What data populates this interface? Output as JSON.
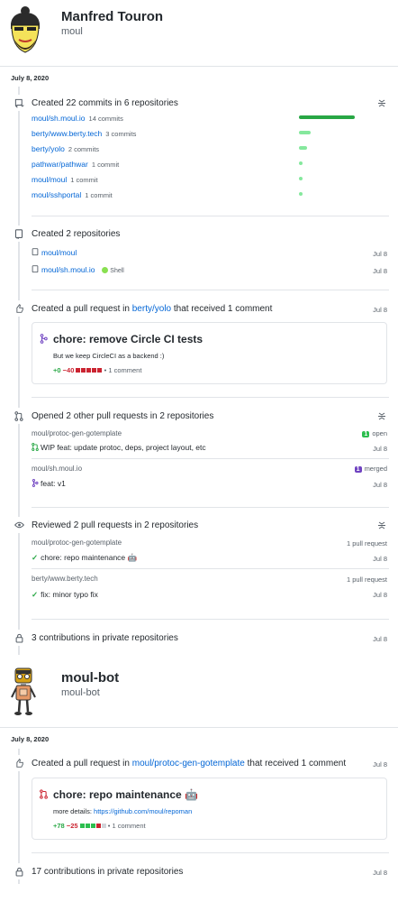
{
  "profile1": {
    "name": "Manfred Touron",
    "login": "moul"
  },
  "day1": {
    "date": "July 8, 2020",
    "commits": {
      "title": "Created 22 commits in 6 repositories",
      "repos": [
        {
          "name": "moul/sh.moul.io",
          "count": "14 commits",
          "value": 14
        },
        {
          "name": "berty/www.berty.tech",
          "count": "3 commits",
          "value": 3
        },
        {
          "name": "berty/yolo",
          "count": "2 commits",
          "value": 2
        },
        {
          "name": "pathwar/pathwar",
          "count": "1 commit",
          "value": 1
        },
        {
          "name": "moul/moul",
          "count": "1 commit",
          "value": 1
        },
        {
          "name": "moul/sshportal",
          "count": "1 commit",
          "value": 1
        }
      ]
    },
    "repos_created": {
      "title": "Created 2 repositories",
      "items": [
        {
          "name": "moul/moul",
          "lang": "",
          "date": "Jul 8"
        },
        {
          "name": "moul/sh.moul.io",
          "lang": "Shell",
          "date": "Jul 8"
        }
      ]
    },
    "pr_created": {
      "prefix": "Created a pull request in",
      "repo": "berty/yolo",
      "suffix": "that received 1 comment",
      "date": "Jul 8",
      "card": {
        "title": "chore: remove Circle CI tests",
        "body": "But we keep CircleCI as a backend :)",
        "additions": "+0",
        "deletions": "−40",
        "comments": "1 comment"
      }
    },
    "opened_prs": {
      "title": "Opened 2 other pull requests in 2 repositories",
      "groups": [
        {
          "repo": "moul/protoc-gen-gotemplate",
          "badge_num": "1",
          "badge_text": "open",
          "pr": "WIP feat: update protoc, deps, project layout, etc",
          "date": "Jul 8"
        },
        {
          "repo": "moul/sh.moul.io",
          "badge_num": "1",
          "badge_text": "merged",
          "pr": "feat: v1",
          "date": "Jul 8"
        }
      ]
    },
    "reviewed": {
      "title": "Reviewed 2 pull requests in 2 repositories",
      "groups": [
        {
          "repo": "moul/protoc-gen-gotemplate",
          "count": "1 pull request",
          "pr": "chore: repo maintenance 🤖",
          "date": "Jul 8"
        },
        {
          "repo": "berty/www.berty.tech",
          "count": "1 pull request",
          "pr": "fix: minor typo fix",
          "date": "Jul 8"
        }
      ]
    },
    "private": {
      "title": "3 contributions in private repositories",
      "date": "Jul 8"
    }
  },
  "profile2": {
    "name": "moul-bot",
    "login": "moul-bot"
  },
  "day2": {
    "date": "July 8, 2020",
    "pr_created": {
      "prefix": "Created a pull request in",
      "repo": "moul/protoc-gen-gotemplate",
      "suffix": "that received 1 comment",
      "date": "Jul 8",
      "card": {
        "title": "chore: repo maintenance 🤖",
        "body_prefix": "more details:",
        "body_link": "https://github.com/moul/repoman",
        "additions": "+78",
        "deletions": "−25",
        "comments": "1 comment"
      }
    },
    "private": {
      "title": "17 contributions in private repositories",
      "date": "Jul 8"
    }
  },
  "colors": {
    "link": "#0366d6",
    "green": "#2cbe4e",
    "red": "#cb2431",
    "purple": "#6f42c1",
    "border": "#e1e4e8"
  }
}
